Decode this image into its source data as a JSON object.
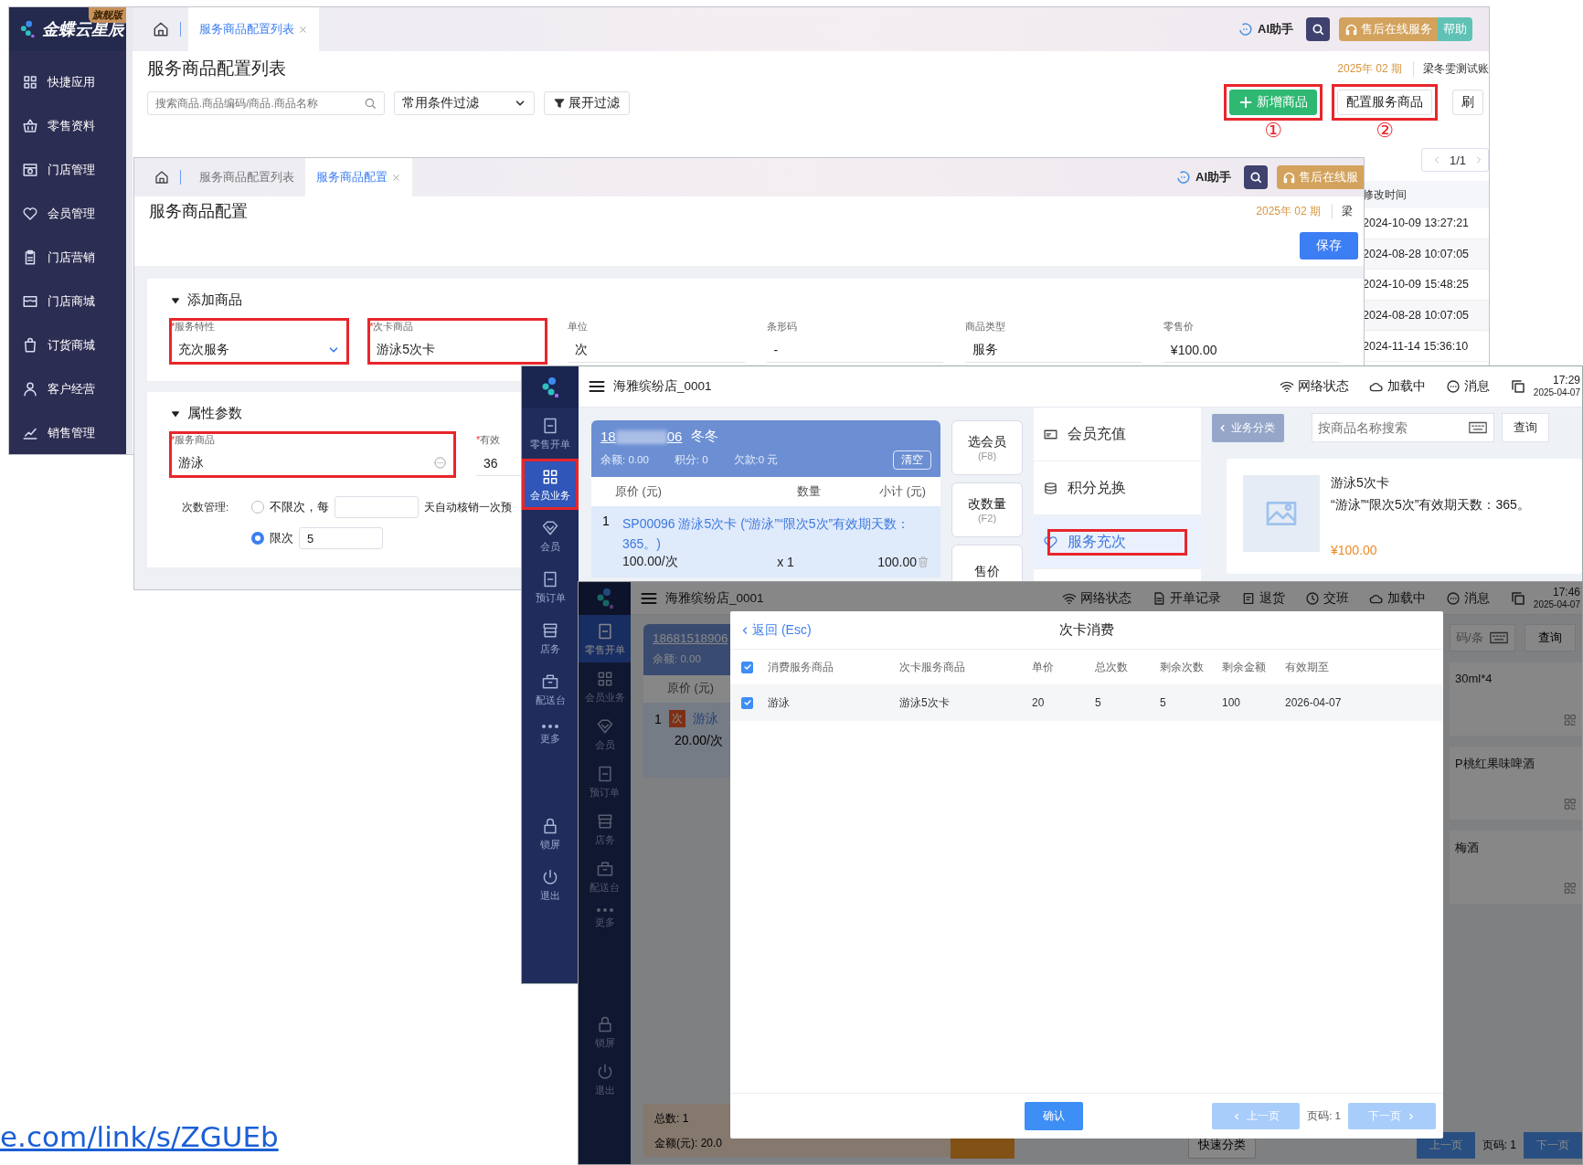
{
  "list_window": {
    "brand": {
      "name": "金蝶云星辰",
      "edition": "旗舰版"
    },
    "sidebar": {
      "items": [
        {
          "label": "快捷应用"
        },
        {
          "label": "零售资料"
        },
        {
          "label": "门店管理"
        },
        {
          "label": "会员管理"
        },
        {
          "label": "门店营销"
        },
        {
          "label": "门店商城"
        },
        {
          "label": "订货商城"
        },
        {
          "label": "客户经营"
        },
        {
          "label": "销售管理"
        }
      ]
    },
    "tabs": [
      {
        "label": "服务商品配置列表",
        "selected": true
      }
    ],
    "header": {
      "assistant": "AI助手",
      "service": "售后在线服务",
      "help": "帮助"
    },
    "title": "服务商品配置列表",
    "period": "2025年 02 期",
    "account": "梁冬雯测试账",
    "search": {
      "placeholder": "搜索商品.商品编码/商品.商品名称"
    },
    "filter_dropdown": "常用条件过滤",
    "expand_filter": "展开过滤",
    "actions": [
      {
        "label": "新增商品",
        "kind": "primary",
        "highlighted": true,
        "step": "①"
      },
      {
        "label": "配置服务商品",
        "kind": "default",
        "highlighted": true,
        "step": "②"
      },
      {
        "label": "刷",
        "kind": "default",
        "highlighted": false
      }
    ],
    "pagination": "1/1",
    "table": {
      "columns": [
        "修改时间"
      ],
      "rows": [
        [
          "2024-10-09 13:27:21"
        ],
        [
          "2024-08-28 10:07:05"
        ],
        [
          "2024-10-09 15:48:25"
        ],
        [
          "2024-08-28 10:07:05"
        ],
        [
          "2024-11-14 15:36:10"
        ]
      ]
    }
  },
  "config_window": {
    "tabs": [
      {
        "label": "服务商品配置列表",
        "selected": false
      },
      {
        "label": "服务商品配置",
        "selected": true
      }
    ],
    "header": {
      "assistant": "AI助手",
      "service": "售后在线服"
    },
    "title": "服务商品配置",
    "period": "2025年 02 期",
    "account": "梁",
    "save": "保存",
    "sections": [
      {
        "title": "添加商品",
        "expanded": true,
        "fields": [
          {
            "mark": "*",
            "label": "服务特性",
            "value": "充次服务",
            "kind": "select",
            "highlighted": true
          },
          {
            "mark": "*",
            "label": "次卡商品",
            "value": "游泳5次卡",
            "kind": "text",
            "highlighted": true
          },
          {
            "label": "单位",
            "value": "次",
            "kind": "text",
            "highlighted": false
          },
          {
            "label": "条形码",
            "value": "-",
            "kind": "text",
            "highlighted": false
          },
          {
            "label": "商品类型",
            "value": "服务",
            "kind": "text",
            "highlighted": false
          },
          {
            "label": "零售价",
            "value": "¥100.00",
            "kind": "text",
            "highlighted": false
          }
        ]
      },
      {
        "title": "属性参数",
        "expanded": true,
        "fields": [
          {
            "mark": "*",
            "label": "服务商品",
            "value": "游泳",
            "kind": "lookup",
            "highlighted": true
          },
          {
            "mark": "*",
            "label": "有效",
            "value": "36",
            "kind": "text",
            "highlighted": false
          }
        ],
        "count_management": {
          "label": "次数管理:",
          "options": [
            {
              "label": "不限次，每",
              "selected": false,
              "suffix": "天自动核销一次预"
            },
            {
              "label": "限次",
              "selected": true,
              "input": "5"
            }
          ]
        }
      }
    ]
  },
  "pos_window": {
    "store": "海雅缤纷店_0001",
    "status": [
      {
        "label": "网络状态"
      },
      {
        "label": "加载中"
      },
      {
        "label": "消息"
      }
    ],
    "time": "17:29",
    "date": "2025-04-07",
    "sidebar": [
      {
        "label": "零售开单",
        "selected": false,
        "highlighted": false
      },
      {
        "label": "会员业务",
        "selected": true,
        "highlighted": true
      },
      {
        "label": "会员",
        "selected": false,
        "highlighted": false
      },
      {
        "label": "预订单",
        "selected": false,
        "highlighted": false
      },
      {
        "label": "店务",
        "selected": false,
        "highlighted": false
      },
      {
        "label": "配送台",
        "selected": false,
        "highlighted": false
      },
      {
        "label": "更多",
        "selected": false,
        "highlighted": false
      },
      {
        "label": "锁屏",
        "selected": false,
        "highlighted": false
      },
      {
        "label": "退出",
        "selected": false,
        "highlighted": false
      }
    ],
    "member": {
      "phone_start": "18",
      "phone_end": "06",
      "name": "冬冬",
      "balance": "余额: 0.00",
      "points": "积分: 0",
      "debt": "欠款:0 元",
      "clear": "清空"
    },
    "cart": {
      "columns": [
        "原价 (元)",
        "数量",
        "小计 (元)"
      ],
      "items": [
        {
          "index": "1",
          "name": "SP00096 游泳5次卡 (“游泳”“限次5次”有效期天数：365。)",
          "price": "100.00/次",
          "qty": "x 1",
          "subtotal": "100.00"
        }
      ]
    },
    "keys": [
      {
        "label": "选会员",
        "shortcut": "(F8)"
      },
      {
        "label": "改数量",
        "shortcut": "(F2)"
      },
      {
        "label": "售价"
      }
    ],
    "menu": [
      {
        "label": "会员充值",
        "selected": false,
        "highlighted": false
      },
      {
        "label": "积分兑换",
        "selected": false,
        "highlighted": false
      },
      {
        "label": "服务充次",
        "selected": true,
        "highlighted": true
      }
    ],
    "category_button": "业务分类",
    "search": {
      "placeholder": "按商品名称搜索"
    },
    "query": "查询",
    "products": [
      {
        "name": "游泳5次卡",
        "description": "“游泳”“限次5次”有效期天数：365。",
        "price": "¥100.00"
      }
    ]
  },
  "modal_window": {
    "store": "海雅缤纷店_0001",
    "status": [
      {
        "label": "网络状态"
      },
      {
        "label": "开单记录"
      },
      {
        "label": "退货"
      },
      {
        "label": "交班"
      },
      {
        "label": "加载中"
      },
      {
        "label": "消息"
      }
    ],
    "time": "17:46",
    "date": "2025-04-07",
    "sidebar": [
      {
        "label": "零售开单",
        "selected": true
      },
      {
        "label": "会员业务",
        "selected": false
      },
      {
        "label": "会员",
        "selected": false
      },
      {
        "label": "预订单",
        "selected": false
      },
      {
        "label": "店务",
        "selected": false
      },
      {
        "label": "配送台",
        "selected": false
      },
      {
        "label": "更多",
        "selected": false
      },
      {
        "label": "锁屏",
        "selected": false
      },
      {
        "label": "退出",
        "selected": false
      }
    ],
    "member": {
      "phone": "18681518906",
      "balance": "余额: 0.00"
    },
    "cart": {
      "column": "原价 (元)",
      "items": [
        {
          "index": "1",
          "badge": "次",
          "name": "游泳",
          "price": "20.00/次"
        }
      ],
      "total_count": "总数: 1",
      "total_amount": "金额(元): 20.0"
    },
    "search_hint": "码/条",
    "query": "查询",
    "products": [
      {
        "name": "30ml*4"
      },
      {
        "name": "P桃红果味啤酒"
      },
      {
        "name": "梅酒"
      }
    ],
    "quick_category": "快速分类",
    "pager": {
      "prev": "上一页",
      "page": "页码: 1",
      "next": "下一页"
    },
    "dialog": {
      "back": "返回 (Esc)",
      "title": "次卡消费",
      "columns": [
        "消费服务商品",
        "次卡服务商品",
        "单价",
        "总次数",
        "剩余次数",
        "剩余金额",
        "有效期至"
      ],
      "all_checked": true,
      "rows": [
        {
          "checked": true,
          "cells": [
            "游泳",
            "游泳5次卡",
            "20",
            "5",
            "5",
            "100",
            "2026-04-07"
          ]
        }
      ],
      "confirm": "确认",
      "prev": "上一页",
      "page": "页码: 1",
      "next": "下一页"
    }
  },
  "link": "e.com/link/s/ZGUEb"
}
